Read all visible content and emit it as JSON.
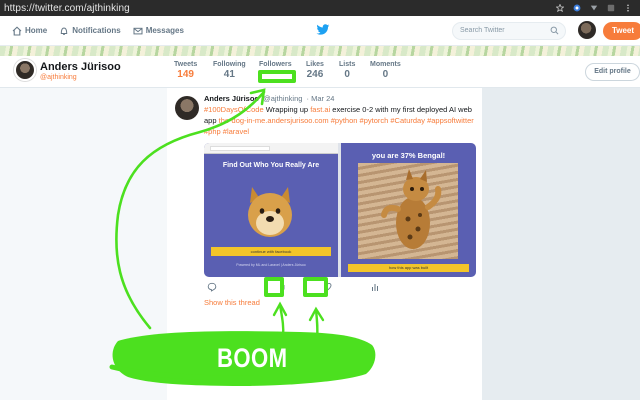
{
  "browser": {
    "url": "https://twitter.com/ajthinking",
    "icons": [
      "star-icon",
      "extension-icon",
      "menu-down-icon",
      "extension-square-icon",
      "more-vertical-icon"
    ]
  },
  "topnav": {
    "home_label": "Home",
    "notifications_label": "Notifications",
    "messages_label": "Messages",
    "search_placeholder": "Search Twitter",
    "tweet_button_label": "Tweet",
    "accent_color": "#f77c3b"
  },
  "profile": {
    "name": "Anders Jürisoo",
    "handle": "@ajthinking",
    "edit_label": "Edit profile",
    "stats": [
      {
        "label": "Tweets",
        "value": "149"
      },
      {
        "label": "Following",
        "value": "41"
      },
      {
        "label": "Followers",
        "value": ""
      },
      {
        "label": "Likes",
        "value": "246"
      },
      {
        "label": "Lists",
        "value": "0"
      },
      {
        "label": "Moments",
        "value": "0"
      }
    ]
  },
  "tweet": {
    "author": "Anders Jürisoo",
    "handle": "@ajthinking",
    "date": "· Mar 24",
    "text_prefix": "#100DaysOfCode",
    "text_body": " Wrapping up ",
    "link1": "fast.ai",
    "text_body2": " exercise 0-2 with my first deployed AI web app ",
    "link2": "the-dog-in-me.andersjurisoo.com",
    "tags": " #python #pytorch #Caturday #appsoftwitter #php #laravel",
    "media": {
      "left_title": "Find Out Who You Really Are",
      "left_button": "continue with facebook",
      "left_footer": "Powered by ML and Laravel | Anders Jürisoo",
      "right_title": "you are 37% Bengal!",
      "right_button": "how this app was built"
    },
    "show_thread": "Show this thread"
  },
  "annotation": {
    "label": "BOOM",
    "color": "#4ce01f"
  }
}
